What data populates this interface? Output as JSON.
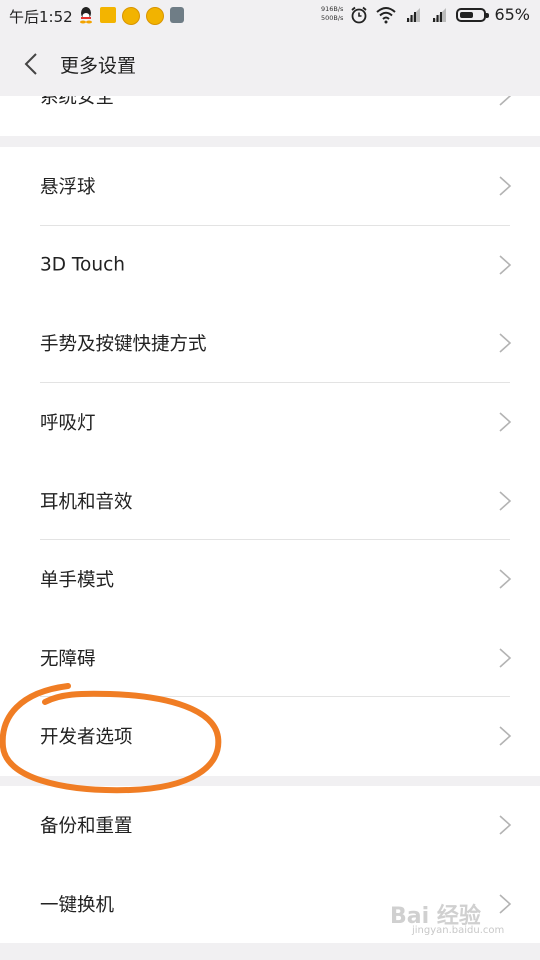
{
  "status_bar": {
    "time": "午后1:52",
    "net_up": "916B/s",
    "net_down": "500B/s",
    "battery_percent": "65%",
    "battery_level": 0.65
  },
  "header": {
    "title": "更多设置"
  },
  "groups": [
    {
      "items": [
        {
          "label": "系统安全"
        }
      ]
    },
    {
      "items": [
        {
          "label": "悬浮球"
        },
        {
          "label": "3D Touch"
        },
        {
          "label": "手势及按键快捷方式"
        },
        {
          "label": "呼吸灯"
        },
        {
          "label": "耳机和音效"
        },
        {
          "label": "单手模式"
        },
        {
          "label": "无障碍"
        },
        {
          "label": "开发者选项"
        }
      ]
    },
    {
      "items": [
        {
          "label": "备份和重置"
        },
        {
          "label": "一键换机"
        }
      ]
    }
  ],
  "watermark": {
    "brand": "Bai 经验",
    "url": "jingyan.baidu.com"
  },
  "colors": {
    "annotation": "#f07d24",
    "background": "#f1f0f2",
    "row_bg": "#ffffff"
  }
}
